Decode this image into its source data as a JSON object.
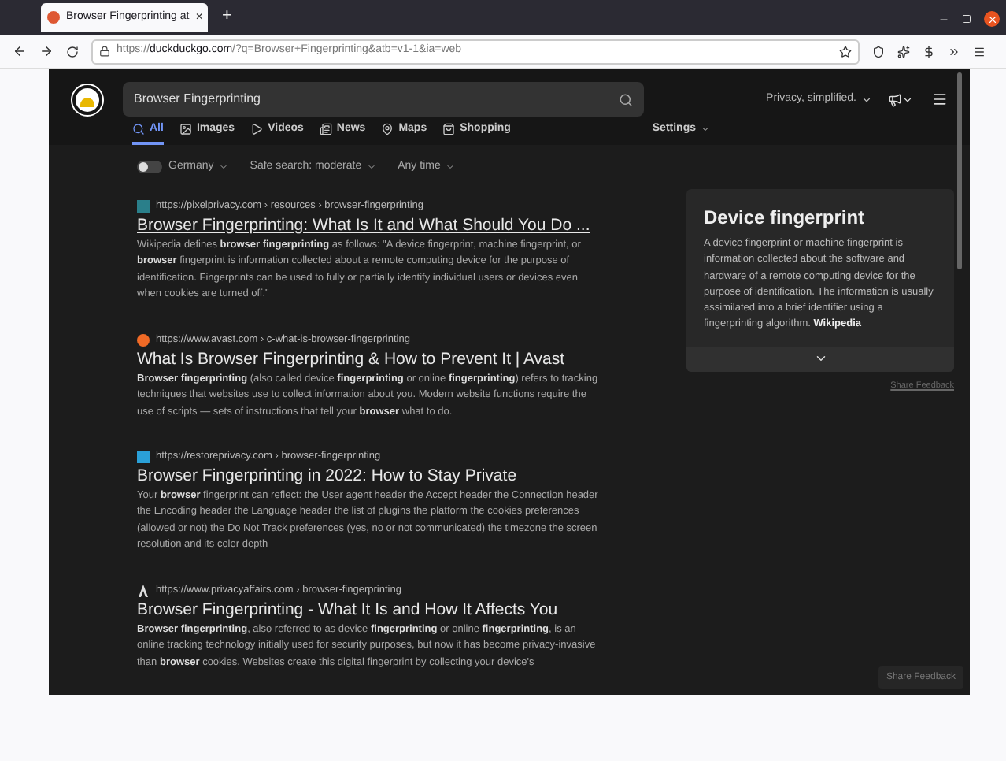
{
  "browser": {
    "tab": {
      "title": "Browser Fingerprinting at",
      "close": "×"
    },
    "new_tab": "+",
    "url": {
      "scheme": "https://",
      "domain": "duckduckgo.com",
      "rest": "/?q=Browser+Fingerprinting&atb=v1-1&ia=web"
    }
  },
  "search": {
    "value": "Browser Fingerprinting"
  },
  "header": {
    "tagline": "Privacy, simplified."
  },
  "nav": {
    "tabs": [
      {
        "label": "All",
        "selected": true
      },
      {
        "label": "Images",
        "selected": false
      },
      {
        "label": "Videos",
        "selected": false
      },
      {
        "label": "News",
        "selected": false
      },
      {
        "label": "Maps",
        "selected": false
      },
      {
        "label": "Shopping",
        "selected": false
      }
    ],
    "settings": "Settings"
  },
  "filters": {
    "region": {
      "label": "Germany",
      "on": false
    },
    "safe_search": "Safe search: moderate",
    "time": "Any time"
  },
  "results": [
    {
      "url": "https://pixelprivacy.com › resources › browser-fingerprinting",
      "title": "Browser Fingerprinting: What Is It and What Should You Do ...",
      "hovered": true,
      "snippet": "Wikipedia defines **browser fingerprinting** as follows: \"A device fingerprint, machine fingerprint, or **browser** fingerprint is information collected about a remote computing device for the purpose of identification. Fingerprints can be used to fully or partially identify individual users or devices even when cookies are turned off.\""
    },
    {
      "url": "https://www.avast.com › c-what-is-browser-fingerprinting",
      "title": "What Is Browser Fingerprinting & How to Prevent It | Avast",
      "hovered": false,
      "snippet": "**Browser fingerprinting** (also called device **fingerprinting** or online **fingerprinting**) refers to tracking techniques that websites use to collect information about you. Modern website functions require the use of scripts — sets of instructions that tell your **browser** what to do."
    },
    {
      "url": "https://restoreprivacy.com › browser-fingerprinting",
      "title": "Browser Fingerprinting in 2022: How to Stay Private",
      "hovered": false,
      "snippet": "Your **browser** fingerprint can reflect: the User agent header the Accept header the Connection header the Encoding header the Language header the list of plugins the platform the cookies preferences (allowed or not) the Do Not Track preferences (yes, no or not communicated) the timezone the screen resolution and its color depth"
    },
    {
      "url": "https://www.privacyaffairs.com › browser-fingerprinting",
      "title": "Browser Fingerprinting - What It Is and How It Affects You",
      "hovered": false,
      "snippet": "**Browser fingerprinting**, also referred to as device **fingerprinting** or online **fingerprinting**, is an online tracking technology initially used for security purposes, but now it has become privacy-invasive than **browser** cookies. Websites create this digital fingerprint by collecting your device's"
    }
  ],
  "infobox": {
    "title": "Device fingerprint",
    "text": "A device fingerprint or machine fingerprint is information collected about the software and hardware of a remote computing device for the purpose of identification. The information is usually assimilated into a brief identifier using a fingerprinting algorithm. **Wikipedia**",
    "feedback": "Share Feedback"
  },
  "footer_feedback": "Share Feedback"
}
